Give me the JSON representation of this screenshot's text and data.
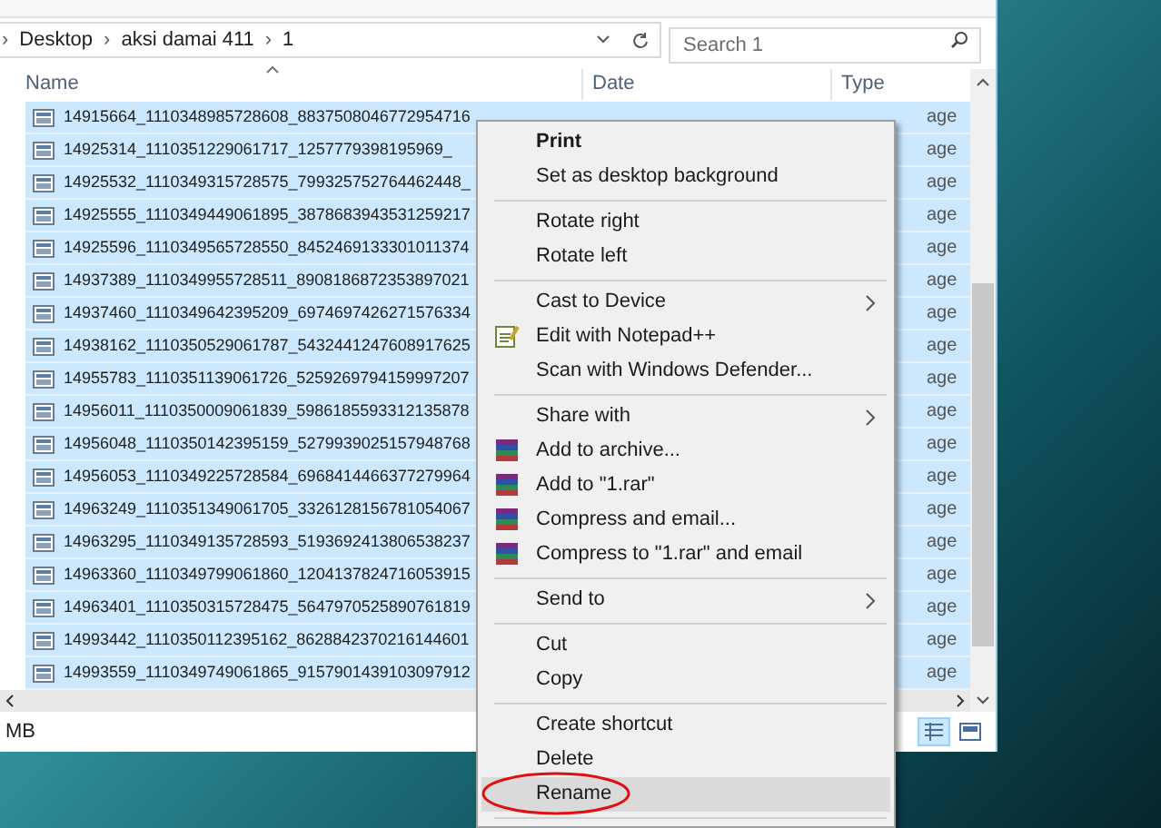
{
  "address_bar": {
    "path": [
      {
        "separator": "›",
        "label": "Desktop"
      },
      {
        "separator": "›",
        "label": "aksi damai 411"
      },
      {
        "separator": "›",
        "label": "1"
      }
    ],
    "search_placeholder": "Search 1"
  },
  "columns": [
    {
      "label": "Name",
      "sorted": true
    },
    {
      "label": "Date",
      "sorted": false
    },
    {
      "label": "Type",
      "sorted": false
    }
  ],
  "rows": [
    {
      "name": "14915664_1110348985728608_8837508046772954716",
      "type": "age",
      "selected": true
    },
    {
      "name": "14925314_1110351229061717_1257779398195969_",
      "type": "age",
      "selected": true
    },
    {
      "name": "14925532_1110349315728575_799325752764462448_",
      "type": "age",
      "selected": true
    },
    {
      "name": "14925555_1110349449061895_3878683943531259217",
      "type": "age",
      "selected": true
    },
    {
      "name": "14925596_1110349565728550_8452469133301011374",
      "type": "age",
      "selected": true
    },
    {
      "name": "14937389_1110349955728511_8908186872353897021",
      "type": "age",
      "selected": true
    },
    {
      "name": "14937460_1110349642395209_6974697426271576334",
      "type": "age",
      "selected": true
    },
    {
      "name": "14938162_1110350529061787_5432441247608917625",
      "type": "age",
      "selected": true
    },
    {
      "name": "14955783_1110351139061726_5259269794159997207",
      "type": "age",
      "selected": true
    },
    {
      "name": "14956011_1110350009061839_5986185593312135878",
      "type": "age",
      "selected": true
    },
    {
      "name": "14956048_1110350142395159_5279939025157948768",
      "type": "age",
      "selected": true
    },
    {
      "name": "14956053_1110349225728584_6968414466377279964",
      "type": "age",
      "selected": true
    },
    {
      "name": "14963249_1110351349061705_3326128156781054067",
      "type": "age",
      "selected": true
    },
    {
      "name": "14963295_1110349135728593_5193692413806538237",
      "type": "age",
      "selected": true
    },
    {
      "name": "14963360_1110349799061860_1204137824716053915",
      "type": "age",
      "selected": true
    },
    {
      "name": "14963401_1110350315728475_5647970525890761819",
      "type": "age",
      "selected": true
    },
    {
      "name": "14993442_1110350112395162_8628842370216144601",
      "type": "age",
      "selected": true
    },
    {
      "name": "14993559_1110349749061865_9157901439103097912",
      "type": "age",
      "selected": true
    }
  ],
  "status_bar": {
    "text": "MB",
    "views": [
      {
        "kind": "details",
        "selected": true
      },
      {
        "kind": "thumbnails",
        "selected": false
      }
    ]
  },
  "context_menu": [
    {
      "kind": "item",
      "label": "Print",
      "bold": true
    },
    {
      "kind": "item",
      "label": "Set as desktop background"
    },
    {
      "kind": "separator"
    },
    {
      "kind": "item",
      "label": "Rotate right"
    },
    {
      "kind": "item",
      "label": "Rotate left"
    },
    {
      "kind": "separator"
    },
    {
      "kind": "item",
      "label": "Cast to Device",
      "submenu": true
    },
    {
      "kind": "notepad",
      "label": "Edit with Notepad++"
    },
    {
      "kind": "item",
      "label": "Scan with Windows Defender..."
    },
    {
      "kind": "separator"
    },
    {
      "kind": "item",
      "label": "Share with",
      "submenu": true
    },
    {
      "kind": "archive",
      "label": "Add to archive..."
    },
    {
      "kind": "archive",
      "label": "Add to \"1.rar\""
    },
    {
      "kind": "archive",
      "label": "Compress and email..."
    },
    {
      "kind": "archive",
      "label": "Compress to \"1.rar\" and email"
    },
    {
      "kind": "separator"
    },
    {
      "kind": "item",
      "label": "Send to",
      "submenu": true
    },
    {
      "kind": "separator"
    },
    {
      "kind": "item",
      "label": "Cut"
    },
    {
      "kind": "item",
      "label": "Copy"
    },
    {
      "kind": "separator"
    },
    {
      "kind": "item",
      "label": "Create shortcut"
    },
    {
      "kind": "item",
      "label": "Delete"
    },
    {
      "kind": "item",
      "label": "Rename",
      "highlighted": true,
      "circled": true
    },
    {
      "kind": "separator"
    }
  ]
}
